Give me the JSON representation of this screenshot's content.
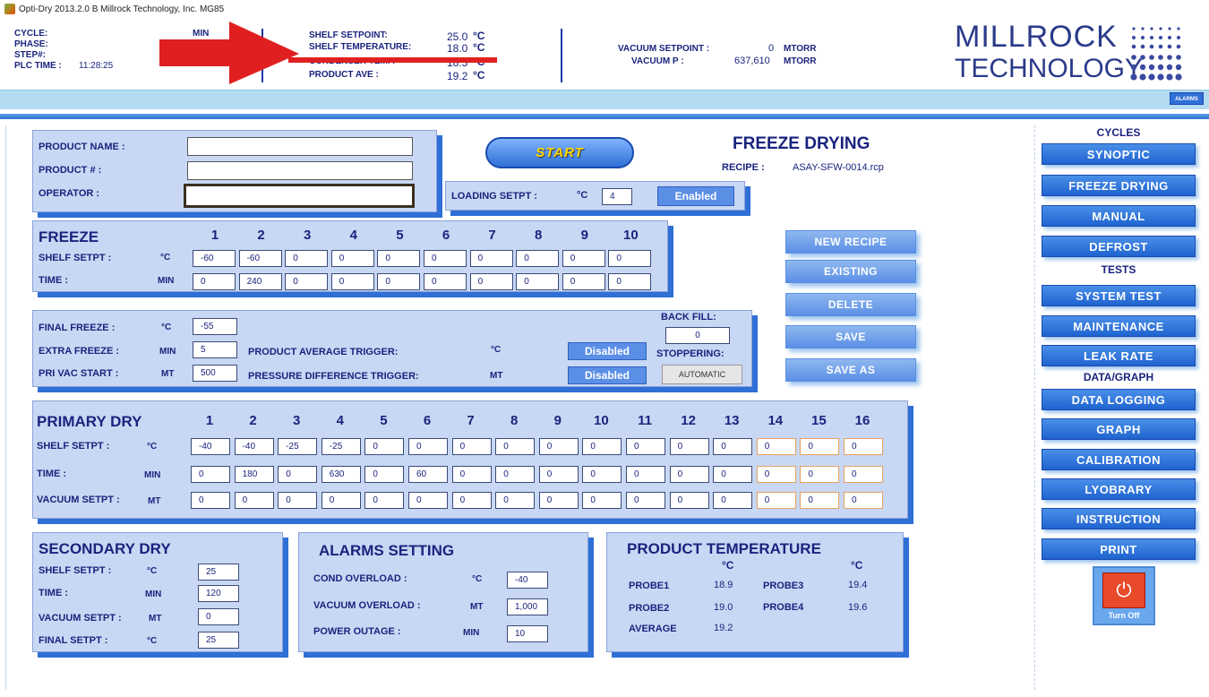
{
  "window": {
    "title": "Opti-Dry 2013.2.0 B   Millrock Technology, Inc. MG85"
  },
  "header": {
    "cycle_label": "CYCLE:",
    "phase_label": "PHASE:",
    "step_label": "STEP#:",
    "plc_time_label": "PLC TIME :",
    "plc_time_value": "11:28:25",
    "min_label": "MIN",
    "shelf_setpoint_label": "SHELF SETPOINT:",
    "shelf_setpoint_value": "25.0",
    "shelf_temperature_label": "SHELF TEMPERATURE:",
    "shelf_temperature_value": "18.0",
    "condenser_temp_label": "CONDENSER TEMP.",
    "condenser_temp_value": "18.5",
    "product_ave_label": "PRODUCT AVE :",
    "product_ave_value": "19.2",
    "deg_unit": "°C",
    "vacuum_setpoint_label": "VACUUM SETPOINT :",
    "vacuum_setpoint_value": "0",
    "vacuum_p_label": "VACUUM P :",
    "vacuum_p_value": "637,610",
    "mtorr_unit": "MTORR",
    "logo_line1": "MILLROCK",
    "logo_line2": "TECHNOLOGY",
    "alarms_button": "ALARMS"
  },
  "product": {
    "name_label": "PRODUCT NAME :",
    "number_label": "PRODUCT # :",
    "operator_label": "OPERATOR :",
    "name_value": "",
    "number_value": "",
    "operator_value": ""
  },
  "start_button": "START",
  "loading": {
    "label": "LOADING SETPT :",
    "unit": "°C",
    "value": "4",
    "status": "Enabled"
  },
  "page_title": "FREEZE DRYING",
  "recipe": {
    "label": "RECIPE :",
    "value": "ASAY-SFW-0014.rcp"
  },
  "freeze": {
    "title": "FREEZE",
    "columns": [
      "1",
      "2",
      "3",
      "4",
      "5",
      "6",
      "7",
      "8",
      "9",
      "10"
    ],
    "shelf_label": "SHELF SETPT :",
    "shelf_unit": "°C",
    "shelf_values": [
      "-60",
      "-60",
      "0",
      "0",
      "0",
      "0",
      "0",
      "0",
      "0",
      "0"
    ],
    "time_label": "TIME :",
    "time_unit": "MIN",
    "time_values": [
      "0",
      "240",
      "0",
      "0",
      "0",
      "0",
      "0",
      "0",
      "0",
      "0"
    ]
  },
  "final": {
    "final_freeze_label": "FINAL FREEZE :",
    "final_freeze_unit": "°C",
    "final_freeze_value": "-55",
    "extra_freeze_label": "EXTRA FREEZE :",
    "extra_freeze_unit": "MIN",
    "extra_freeze_value": "5",
    "pri_vac_label": "PRI VAC START :",
    "pri_vac_unit": "MT",
    "pri_vac_value": "500",
    "product_avg_trigger_label": "PRODUCT AVERAGE TRIGGER:",
    "product_avg_trigger_unit": "°C",
    "product_avg_trigger_status": "Disabled",
    "pressure_diff_trigger_label": "PRESSURE DIFFERENCE TRIGGER:",
    "pressure_diff_trigger_unit": "MT",
    "pressure_diff_trigger_status": "Disabled",
    "back_fill_label": "BACK FILL:",
    "back_fill_value": "0",
    "stoppering_label": "STOPPERING:",
    "stoppering_value": "AUTOMATIC"
  },
  "recipe_buttons": {
    "new": "NEW RECIPE",
    "existing": "EXISTING",
    "delete": "DELETE",
    "save": "SAVE",
    "save_as": "SAVE AS"
  },
  "primary": {
    "title": "PRIMARY DRY",
    "columns": [
      "1",
      "2",
      "3",
      "4",
      "5",
      "6",
      "7",
      "8",
      "9",
      "10",
      "11",
      "12",
      "13",
      "14",
      "15",
      "16"
    ],
    "shelf_label": "SHELF SETPT :",
    "shelf_unit": "°C",
    "shelf_values": [
      "-40",
      "-40",
      "-25",
      "-25",
      "0",
      "0",
      "0",
      "0",
      "0",
      "0",
      "0",
      "0",
      "0",
      "0",
      "0",
      "0"
    ],
    "time_label": "TIME :",
    "time_unit": "MIN",
    "time_values": [
      "0",
      "180",
      "0",
      "630",
      "0",
      "60",
      "0",
      "0",
      "0",
      "0",
      "0",
      "0",
      "0",
      "0",
      "0",
      "0"
    ],
    "vacuum_label": "VACUUM SETPT :",
    "vacuum_unit": "MT",
    "vacuum_values": [
      "0",
      "0",
      "0",
      "0",
      "0",
      "0",
      "0",
      "0",
      "0",
      "0",
      "0",
      "0",
      "0",
      "0",
      "0",
      "0"
    ]
  },
  "secondary": {
    "title": "SECONDARY DRY",
    "shelf_label": "SHELF SETPT :",
    "shelf_unit": "°C",
    "shelf_value": "25",
    "time_label": "TIME :",
    "time_unit": "MIN",
    "time_value": "120",
    "vacuum_label": "VACUUM SETPT :",
    "vacuum_unit": "MT",
    "vacuum_value": "0",
    "final_label": "FINAL SETPT :",
    "final_unit": "°C",
    "final_value": "25"
  },
  "alarms": {
    "title": "ALARMS SETTING",
    "cond_label": "COND OVERLOAD :",
    "cond_unit": "°C",
    "cond_value": "-40",
    "vac_label": "VACUUM OVERLOAD :",
    "vac_unit": "MT",
    "vac_value": "1,000",
    "power_label": "POWER OUTAGE :",
    "power_unit": "MIN",
    "power_value": "10"
  },
  "product_temp": {
    "title": "PRODUCT TEMPERATURE",
    "unit": "°C",
    "probe1_label": "PROBE1",
    "probe1_value": "18.9",
    "probe2_label": "PROBE2",
    "probe2_value": "19.0",
    "probe3_label": "PROBE3",
    "probe3_value": "19.4",
    "probe4_label": "PROBE4",
    "probe4_value": "19.6",
    "average_label": "AVERAGE",
    "average_value": "19.2"
  },
  "sidebar": {
    "cycles_heading": "CYCLES",
    "synoptic": "SYNOPTIC",
    "freeze_drying": "FREEZE DRYING",
    "manual": "MANUAL",
    "defrost": "DEFROST",
    "tests_heading": "TESTS",
    "system_test": "SYSTEM TEST",
    "maintenance": "MAINTENANCE",
    "leak_rate": "LEAK RATE",
    "data_heading": "DATA/GRAPH",
    "data_logging": "DATA LOGGING",
    "graph": "GRAPH",
    "calibration": "CALIBRATION",
    "lyobrary": "LYOBRARY",
    "instruction": "INSTRUCTION",
    "print": "PRINT",
    "turn_off": "Turn Off"
  },
  "colors": {
    "accent_blue": "#2f6fd6",
    "panel_bg": "#c8d8f4",
    "annotation_red": "#e02020",
    "start_text": "#ffd800"
  }
}
